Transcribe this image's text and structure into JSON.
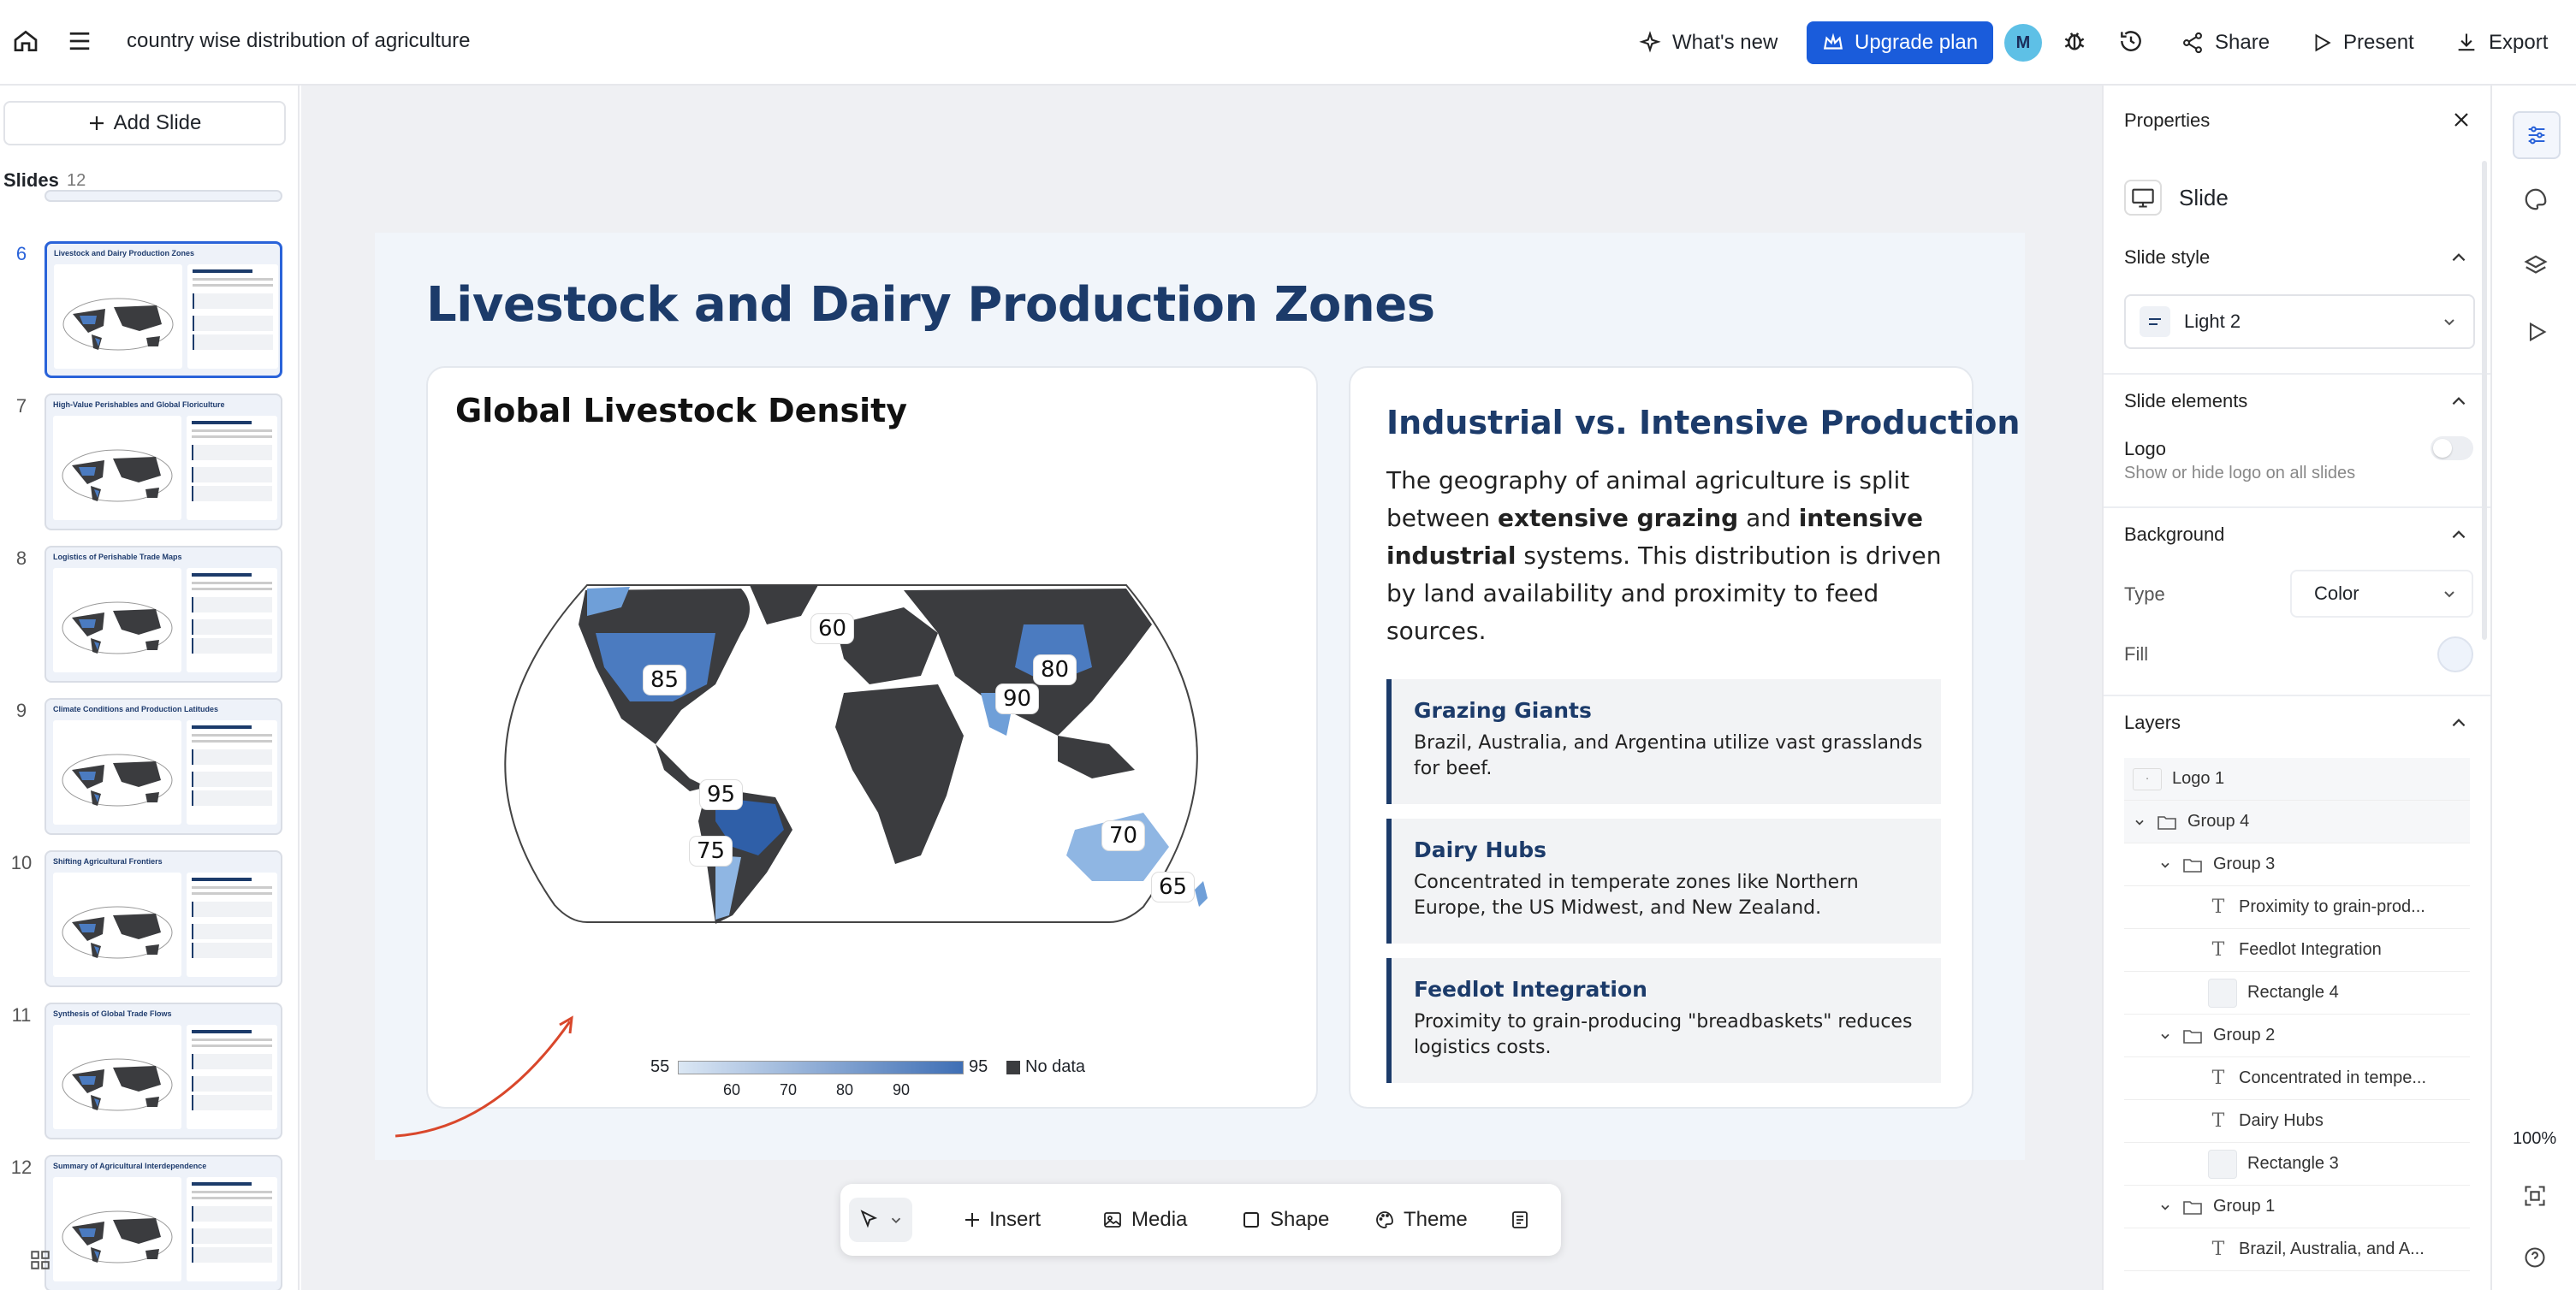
{
  "topbar": {
    "doc_title": "country wise distribution of agriculture",
    "whats_new": "What's new",
    "upgrade": "Upgrade plan",
    "avatar_initial": "M",
    "share": "Share",
    "present": "Present",
    "export": "Export"
  },
  "left": {
    "add_slide": "Add Slide",
    "slides_label": "Slides",
    "slides_count": "12",
    "thumbs": [
      {
        "num": "6",
        "title": "Livestock and Dairy Production Zones"
      },
      {
        "num": "7",
        "title": "High-Value Perishables and Global Floriculture"
      },
      {
        "num": "8",
        "title": "Logistics of Perishable Trade Maps"
      },
      {
        "num": "9",
        "title": "Climate Conditions and Production Latitudes"
      },
      {
        "num": "10",
        "title": "Shifting Agricultural Frontiers"
      },
      {
        "num": "11",
        "title": "Synthesis of Global Trade Flows"
      },
      {
        "num": "12",
        "title": "Summary of Agricultural Interdependence"
      }
    ]
  },
  "slide": {
    "title": "Livestock and Dairy Production Zones",
    "map_title": "Global Livestock Density",
    "map_labels": [
      "85",
      "60",
      "80",
      "90",
      "95",
      "75",
      "70",
      "65"
    ],
    "legend": {
      "min": "55",
      "max": "95",
      "ticks": [
        "60",
        "70",
        "80",
        "90"
      ],
      "nodata": "No data"
    },
    "text_title": "Industrial vs. Intensive Production",
    "body_1": "The geography of animal agriculture is split between ",
    "body_b1": "extensive grazing",
    "body_2": " and ",
    "body_b2": "intensive industrial",
    "body_3": " systems. This distribution is driven by land availability and proximity to feed sources.",
    "boxes": [
      {
        "title": "Grazing Giants",
        "text": "Brazil, Australia, and Argentina utilize vast grasslands for beef."
      },
      {
        "title": "Dairy Hubs",
        "text": "Concentrated in temperate zones like Northern Europe, the US Midwest, and New Zealand."
      },
      {
        "title": "Feedlot Integration",
        "text": "Proximity to grain-producing \"breadbaskets\" reduces logistics costs."
      }
    ]
  },
  "toolbar": {
    "insert": "Insert",
    "media": "Media",
    "shape": "Shape",
    "theme": "Theme"
  },
  "props": {
    "header": "Properties",
    "slide": "Slide",
    "slide_style": "Slide style",
    "style_value": "Light 2",
    "slide_elements": "Slide elements",
    "logo": "Logo",
    "logo_hint": "Show or hide logo on all slides",
    "background": "Background",
    "type_label": "Type",
    "type_value": "Color",
    "fill_label": "Fill",
    "fill_color": "#eef3fb",
    "layers": "Layers",
    "layer_items": [
      "Logo 1",
      "Group 4",
      "Group 3",
      "Proximity to grain-prod...",
      "Feedlot Integration",
      "Rectangle 4",
      "Group 2",
      "Concentrated in tempe...",
      "Dairy Hubs",
      "Rectangle 3",
      "Group 1",
      "Brazil, Australia, and A..."
    ],
    "zoom": "100%"
  },
  "colors": {
    "accent": "#1a5cdb",
    "navy": "#1c3b6a",
    "map_dark": "#3b3c3f",
    "map_blue": "#4b7bc0"
  }
}
